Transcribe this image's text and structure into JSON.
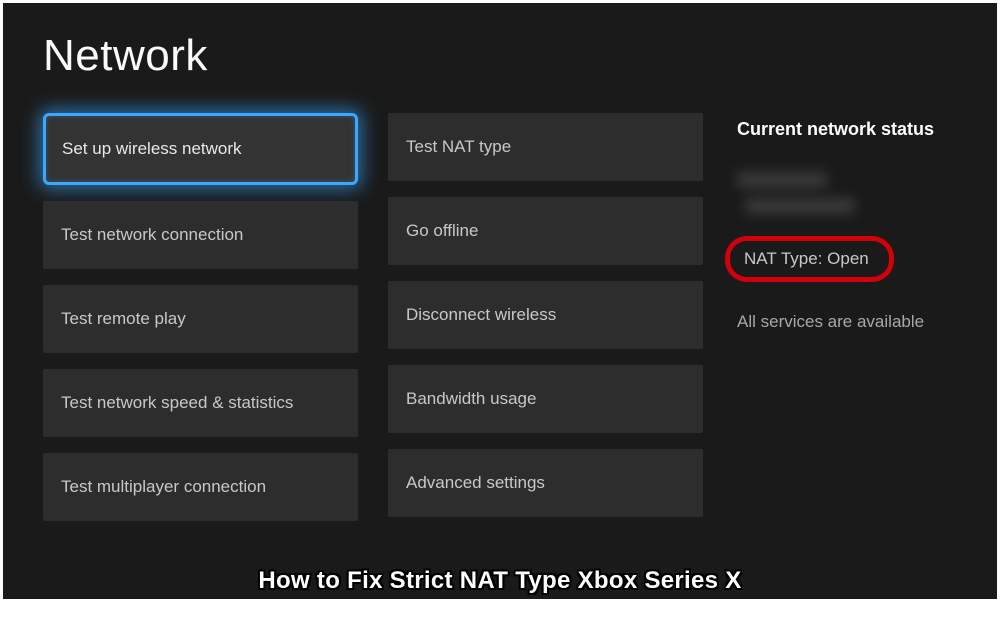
{
  "page": {
    "title": "Network"
  },
  "buttons": {
    "col1": [
      {
        "label": "Set up wireless network",
        "selected": true
      },
      {
        "label": "Test network connection",
        "selected": false
      },
      {
        "label": "Test remote play",
        "selected": false
      },
      {
        "label": "Test network speed & statistics",
        "selected": false
      },
      {
        "label": "Test multiplayer connection",
        "selected": false
      }
    ],
    "col2": [
      {
        "label": "Test NAT type",
        "selected": false
      },
      {
        "label": "Go offline",
        "selected": false
      },
      {
        "label": "Disconnect wireless",
        "selected": false
      },
      {
        "label": "Bandwidth usage",
        "selected": false
      },
      {
        "label": "Advanced settings",
        "selected": false
      }
    ]
  },
  "status": {
    "heading": "Current network status",
    "nat_type": "NAT Type: Open",
    "services": "All services are available"
  },
  "caption": "How to Fix Strict NAT Type Xbox Series X"
}
